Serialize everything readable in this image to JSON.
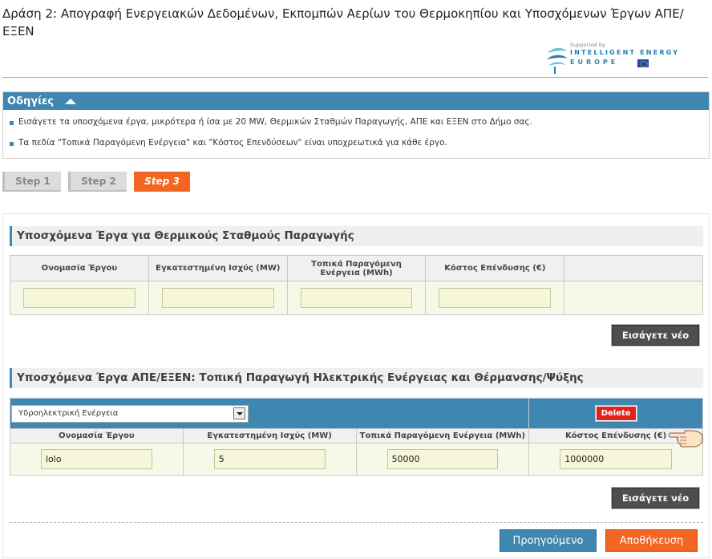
{
  "page_title": "Δράση 2: Απογραφή Ενεργειακών Δεδομένων, Εκπομπών Αερίων του Θερμοκηπίου και Υποσχόμενων Έργων ΑΠΕ/ΕΞΕΝ",
  "logo": {
    "supported_by": "Supported by",
    "line1": "INTELLIGENT ENERGY",
    "line2": "EUROPE"
  },
  "instructions": {
    "title": "Οδηγίες",
    "items": [
      "Εισάγετε τα υποσχόμενα έργα, μικρότερα ή ίσα με 20 MW, Θερμικών Σταθμών Παραγωγής, ΑΠΕ και ΕΞΕΝ στο Δήμο σας.",
      "Τα πεδία \"Τοπικά Παραγόμενη Ενέργεια\" και \"Κόστος Επενδύσεων\" είναι υποχρεωτικά για κάθε έργο."
    ]
  },
  "steps": [
    "Step 1",
    "Step 2",
    "Step 3"
  ],
  "thermal": {
    "title": "Υποσχόμενα Έργα για Θερμικούς Σταθμούς Παραγωγής",
    "columns": [
      "Ονομασία Έργου",
      "Εγκατεστημένη Ισχύς (MW)",
      "Τοπικά Παραγόμενη Ενέργεια (MWh)",
      "Κόστος Επένδυσης (€)"
    ],
    "row": [
      "",
      "",
      "",
      ""
    ],
    "add_label": "Εισάγετε νέο"
  },
  "res": {
    "title": "Υποσχόμενα Έργα ΑΠΕ/ΕΞΕΝ: Τοπική Παραγωγή Ηλεκτρικής Ενέργειας και Θέρμανσης/Ψύξης",
    "type_selected": "Υδροηλεκτρική Ενέργεια",
    "delete_label": "Delete",
    "columns": [
      "Ονομασία Έργου",
      "Εγκατεστημένη Ισχύς (MW)",
      "Τοπικά Παραγόμενη Ενέργεια (MWh)",
      "Κόστος Επένδυσης (€)"
    ],
    "row": [
      "lolo",
      "5",
      "50000",
      "1000000"
    ],
    "add_label": "Εισάγετε νέο"
  },
  "nav": {
    "previous": "Προηγούμενο",
    "save": "Αποθήκευση"
  },
  "colors": {
    "accent_blue": "#3f86b0",
    "accent_orange": "#f26522",
    "delete_red": "#e0231d"
  }
}
